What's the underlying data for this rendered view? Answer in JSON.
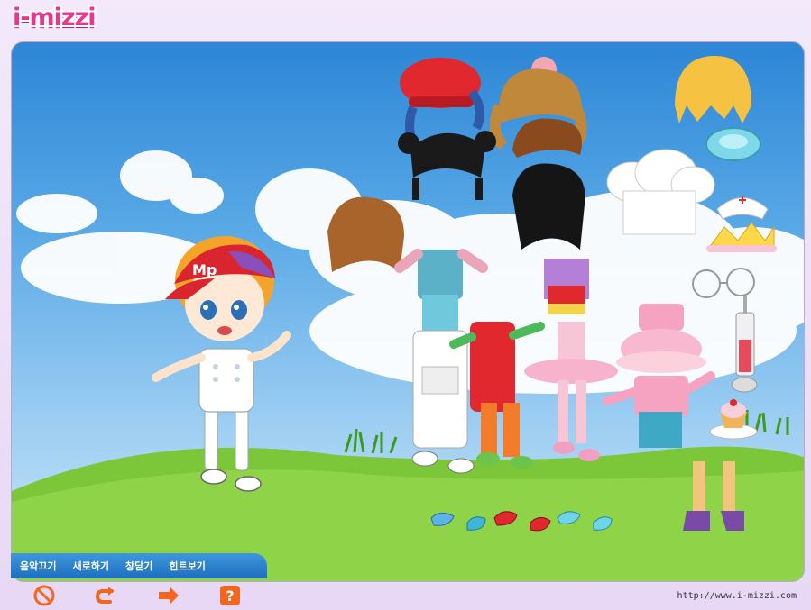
{
  "logo": {
    "text": "i-mizzi"
  },
  "menu": {
    "items": [
      {
        "id": "music-off",
        "label": "음악끄기"
      },
      {
        "id": "reset",
        "label": "새로하기"
      },
      {
        "id": "close-window",
        "label": "창닫기"
      },
      {
        "id": "hint",
        "label": "힌트보기"
      }
    ]
  },
  "controls": {
    "icons": [
      "stop-icon",
      "undo-icon",
      "next-arrow-icon",
      "help-icon"
    ],
    "help_glyph": "?"
  },
  "footer": {
    "url": "http://www.i-mizzi.com"
  },
  "colors": {
    "sky_top": "#2d86d6",
    "grass": "#7cc63a",
    "brand_pink": "#e8378f",
    "control_orange": "#f2661d"
  },
  "character": {
    "cap_text": "Mp"
  }
}
